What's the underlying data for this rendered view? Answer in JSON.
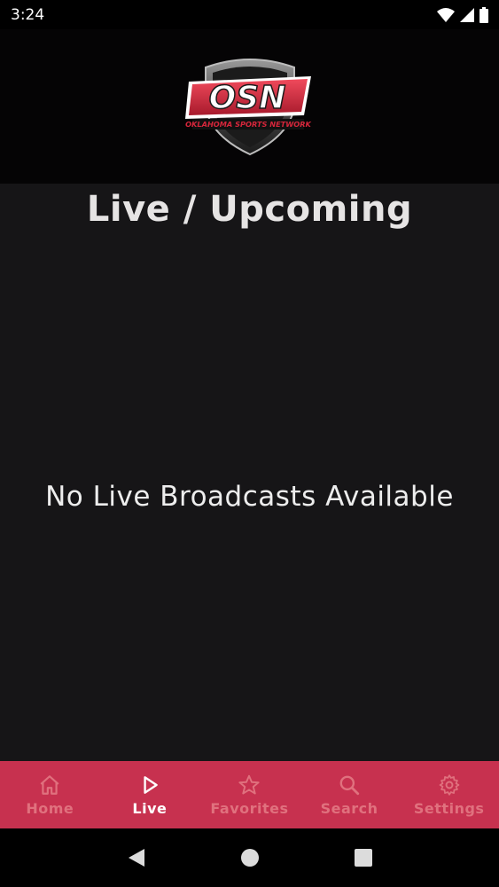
{
  "status_bar": {
    "time": "3:24",
    "icons": [
      "wifi-icon",
      "signal-icon",
      "battery-icon"
    ]
  },
  "logo": {
    "text": "OSN",
    "tagline": "OKLAHOMA SPORTS NETWORK",
    "brand_color": "#d6263b"
  },
  "page": {
    "title": "Live / Upcoming",
    "empty_message": "No Live Broadcasts Available"
  },
  "bottom_nav": {
    "background": "#c7314f",
    "items": [
      {
        "label": "Home",
        "icon": "home-icon",
        "active": false
      },
      {
        "label": "Live",
        "icon": "play-icon",
        "active": true
      },
      {
        "label": "Favorites",
        "icon": "star-icon",
        "active": false
      },
      {
        "label": "Search",
        "icon": "search-icon",
        "active": false
      },
      {
        "label": "Settings",
        "icon": "gear-icon",
        "active": false
      }
    ]
  },
  "system_nav": {
    "buttons": [
      "back-icon",
      "home-circle-icon",
      "recents-icon"
    ]
  }
}
